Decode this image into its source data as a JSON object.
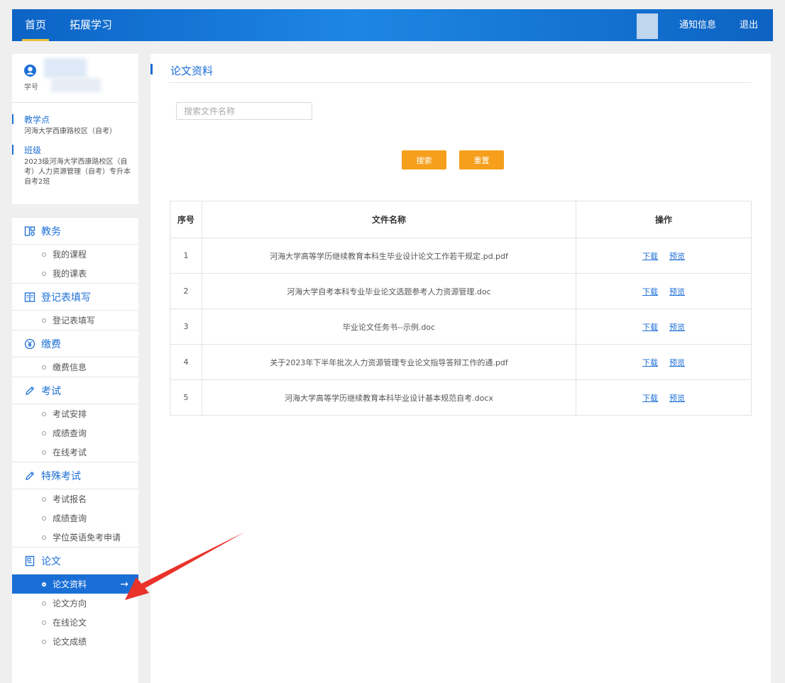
{
  "topbar": {
    "nav_home": "首页",
    "nav_extend": "拓展学习",
    "notice": "通知信息",
    "logout": "退出"
  },
  "profile": {
    "student_id_label": "学号",
    "center_label": "教学点",
    "center_value": "河海大学西康路校区（自考）",
    "class_label": "班级",
    "class_value": "2023级河海大学西康路校区（自考）人力资源管理（自考）专升本自考2班"
  },
  "menu": {
    "sections": [
      {
        "icon": "grid-icon",
        "label": "教务",
        "items": [
          "我的课程",
          "我的课表"
        ]
      },
      {
        "icon": "book-icon",
        "label": "登记表填写",
        "items": [
          "登记表填写"
        ]
      },
      {
        "icon": "yen-icon",
        "label": "缴费",
        "items": [
          "缴费信息"
        ]
      },
      {
        "icon": "pencil-icon",
        "label": "考试",
        "items": [
          "考试安排",
          "成绩查询",
          "在线考试"
        ]
      },
      {
        "icon": "pencil-icon",
        "label": "特殊考试",
        "items": [
          "考试报名",
          "成绩查询",
          "学位英语免考申请"
        ]
      },
      {
        "icon": "document-icon",
        "label": "论文",
        "items": [
          "论文资料",
          "论文方向",
          "在线论文",
          "论文成绩"
        ]
      }
    ],
    "active_item": "论文资料",
    "active_arrow": "→"
  },
  "main": {
    "page_title": "论文资料",
    "search_placeholder": "搜索文件名称",
    "search_button": "搜索",
    "reset_button": "重置",
    "table_headers": [
      "序号",
      "文件名称",
      "操作"
    ],
    "download_label": "下载",
    "preview_label": "预览",
    "rows": [
      {
        "index": "1",
        "name": "河海大学高等学历继续教育本科生毕业设计论文工作若干规定.pd.pdf"
      },
      {
        "index": "2",
        "name": "河海大学自考本科专业毕业论文选题参考人力资源管理.doc"
      },
      {
        "index": "3",
        "name": "毕业论文任务书--示例.doc"
      },
      {
        "index": "4",
        "name": "关于2023年下半年批次人力资源管理专业论文指导答辩工作的通.pdf"
      },
      {
        "index": "5",
        "name": "河海大学高等学历继续教育本科毕业设计基本规范自考.docx"
      }
    ]
  },
  "colors": {
    "brand_blue": "#1d6fd6",
    "button_orange": "#f59f1c",
    "annotation_red": "#e8322a"
  }
}
